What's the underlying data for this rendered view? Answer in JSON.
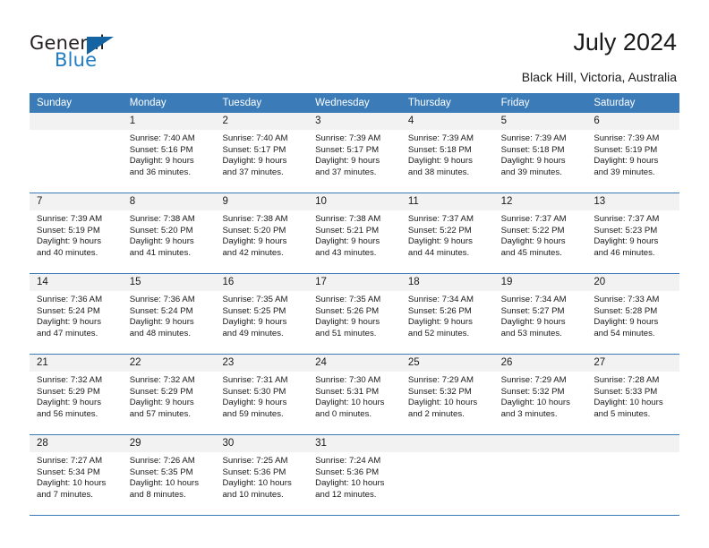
{
  "brand": {
    "name_top": "General",
    "name_bottom": "Blue",
    "triangle_color": "#1463a3",
    "blue_color": "#1f7dc4"
  },
  "header": {
    "title": "July 2024",
    "location": "Black Hill, Victoria, Australia"
  },
  "theme": {
    "header_blue": "#3b7cb8",
    "day_band_gray": "#f2f2f2",
    "cell_white": "#ffffff",
    "text_color": "#1a1a1a"
  },
  "weekdays": [
    "Sunday",
    "Monday",
    "Tuesday",
    "Wednesday",
    "Thursday",
    "Friday",
    "Saturday"
  ],
  "weeks": [
    [
      {
        "day": "",
        "blank": true,
        "sunrise": "",
        "sunset": "",
        "daylight_1": "",
        "daylight_2": ""
      },
      {
        "day": "1",
        "sunrise": "Sunrise: 7:40 AM",
        "sunset": "Sunset: 5:16 PM",
        "daylight_1": "Daylight: 9 hours",
        "daylight_2": "and 36 minutes."
      },
      {
        "day": "2",
        "sunrise": "Sunrise: 7:40 AM",
        "sunset": "Sunset: 5:17 PM",
        "daylight_1": "Daylight: 9 hours",
        "daylight_2": "and 37 minutes."
      },
      {
        "day": "3",
        "sunrise": "Sunrise: 7:39 AM",
        "sunset": "Sunset: 5:17 PM",
        "daylight_1": "Daylight: 9 hours",
        "daylight_2": "and 37 minutes."
      },
      {
        "day": "4",
        "sunrise": "Sunrise: 7:39 AM",
        "sunset": "Sunset: 5:18 PM",
        "daylight_1": "Daylight: 9 hours",
        "daylight_2": "and 38 minutes."
      },
      {
        "day": "5",
        "sunrise": "Sunrise: 7:39 AM",
        "sunset": "Sunset: 5:18 PM",
        "daylight_1": "Daylight: 9 hours",
        "daylight_2": "and 39 minutes."
      },
      {
        "day": "6",
        "sunrise": "Sunrise: 7:39 AM",
        "sunset": "Sunset: 5:19 PM",
        "daylight_1": "Daylight: 9 hours",
        "daylight_2": "and 39 minutes."
      }
    ],
    [
      {
        "day": "7",
        "sunrise": "Sunrise: 7:39 AM",
        "sunset": "Sunset: 5:19 PM",
        "daylight_1": "Daylight: 9 hours",
        "daylight_2": "and 40 minutes."
      },
      {
        "day": "8",
        "sunrise": "Sunrise: 7:38 AM",
        "sunset": "Sunset: 5:20 PM",
        "daylight_1": "Daylight: 9 hours",
        "daylight_2": "and 41 minutes."
      },
      {
        "day": "9",
        "sunrise": "Sunrise: 7:38 AM",
        "sunset": "Sunset: 5:20 PM",
        "daylight_1": "Daylight: 9 hours",
        "daylight_2": "and 42 minutes."
      },
      {
        "day": "10",
        "sunrise": "Sunrise: 7:38 AM",
        "sunset": "Sunset: 5:21 PM",
        "daylight_1": "Daylight: 9 hours",
        "daylight_2": "and 43 minutes."
      },
      {
        "day": "11",
        "sunrise": "Sunrise: 7:37 AM",
        "sunset": "Sunset: 5:22 PM",
        "daylight_1": "Daylight: 9 hours",
        "daylight_2": "and 44 minutes."
      },
      {
        "day": "12",
        "sunrise": "Sunrise: 7:37 AM",
        "sunset": "Sunset: 5:22 PM",
        "daylight_1": "Daylight: 9 hours",
        "daylight_2": "and 45 minutes."
      },
      {
        "day": "13",
        "sunrise": "Sunrise: 7:37 AM",
        "sunset": "Sunset: 5:23 PM",
        "daylight_1": "Daylight: 9 hours",
        "daylight_2": "and 46 minutes."
      }
    ],
    [
      {
        "day": "14",
        "sunrise": "Sunrise: 7:36 AM",
        "sunset": "Sunset: 5:24 PM",
        "daylight_1": "Daylight: 9 hours",
        "daylight_2": "and 47 minutes."
      },
      {
        "day": "15",
        "sunrise": "Sunrise: 7:36 AM",
        "sunset": "Sunset: 5:24 PM",
        "daylight_1": "Daylight: 9 hours",
        "daylight_2": "and 48 minutes."
      },
      {
        "day": "16",
        "sunrise": "Sunrise: 7:35 AM",
        "sunset": "Sunset: 5:25 PM",
        "daylight_1": "Daylight: 9 hours",
        "daylight_2": "and 49 minutes."
      },
      {
        "day": "17",
        "sunrise": "Sunrise: 7:35 AM",
        "sunset": "Sunset: 5:26 PM",
        "daylight_1": "Daylight: 9 hours",
        "daylight_2": "and 51 minutes."
      },
      {
        "day": "18",
        "sunrise": "Sunrise: 7:34 AM",
        "sunset": "Sunset: 5:26 PM",
        "daylight_1": "Daylight: 9 hours",
        "daylight_2": "and 52 minutes."
      },
      {
        "day": "19",
        "sunrise": "Sunrise: 7:34 AM",
        "sunset": "Sunset: 5:27 PM",
        "daylight_1": "Daylight: 9 hours",
        "daylight_2": "and 53 minutes."
      },
      {
        "day": "20",
        "sunrise": "Sunrise: 7:33 AM",
        "sunset": "Sunset: 5:28 PM",
        "daylight_1": "Daylight: 9 hours",
        "daylight_2": "and 54 minutes."
      }
    ],
    [
      {
        "day": "21",
        "sunrise": "Sunrise: 7:32 AM",
        "sunset": "Sunset: 5:29 PM",
        "daylight_1": "Daylight: 9 hours",
        "daylight_2": "and 56 minutes."
      },
      {
        "day": "22",
        "sunrise": "Sunrise: 7:32 AM",
        "sunset": "Sunset: 5:29 PM",
        "daylight_1": "Daylight: 9 hours",
        "daylight_2": "and 57 minutes."
      },
      {
        "day": "23",
        "sunrise": "Sunrise: 7:31 AM",
        "sunset": "Sunset: 5:30 PM",
        "daylight_1": "Daylight: 9 hours",
        "daylight_2": "and 59 minutes."
      },
      {
        "day": "24",
        "sunrise": "Sunrise: 7:30 AM",
        "sunset": "Sunset: 5:31 PM",
        "daylight_1": "Daylight: 10 hours",
        "daylight_2": "and 0 minutes."
      },
      {
        "day": "25",
        "sunrise": "Sunrise: 7:29 AM",
        "sunset": "Sunset: 5:32 PM",
        "daylight_1": "Daylight: 10 hours",
        "daylight_2": "and 2 minutes."
      },
      {
        "day": "26",
        "sunrise": "Sunrise: 7:29 AM",
        "sunset": "Sunset: 5:32 PM",
        "daylight_1": "Daylight: 10 hours",
        "daylight_2": "and 3 minutes."
      },
      {
        "day": "27",
        "sunrise": "Sunrise: 7:28 AM",
        "sunset": "Sunset: 5:33 PM",
        "daylight_1": "Daylight: 10 hours",
        "daylight_2": "and 5 minutes."
      }
    ],
    [
      {
        "day": "28",
        "sunrise": "Sunrise: 7:27 AM",
        "sunset": "Sunset: 5:34 PM",
        "daylight_1": "Daylight: 10 hours",
        "daylight_2": "and 7 minutes."
      },
      {
        "day": "29",
        "sunrise": "Sunrise: 7:26 AM",
        "sunset": "Sunset: 5:35 PM",
        "daylight_1": "Daylight: 10 hours",
        "daylight_2": "and 8 minutes."
      },
      {
        "day": "30",
        "sunrise": "Sunrise: 7:25 AM",
        "sunset": "Sunset: 5:36 PM",
        "daylight_1": "Daylight: 10 hours",
        "daylight_2": "and 10 minutes."
      },
      {
        "day": "31",
        "sunrise": "Sunrise: 7:24 AM",
        "sunset": "Sunset: 5:36 PM",
        "daylight_1": "Daylight: 10 hours",
        "daylight_2": "and 12 minutes."
      },
      {
        "day": "",
        "blank": true,
        "sunrise": "",
        "sunset": "",
        "daylight_1": "",
        "daylight_2": ""
      },
      {
        "day": "",
        "blank": true,
        "sunrise": "",
        "sunset": "",
        "daylight_1": "",
        "daylight_2": ""
      },
      {
        "day": "",
        "blank": true,
        "sunrise": "",
        "sunset": "",
        "daylight_1": "",
        "daylight_2": ""
      }
    ]
  ]
}
